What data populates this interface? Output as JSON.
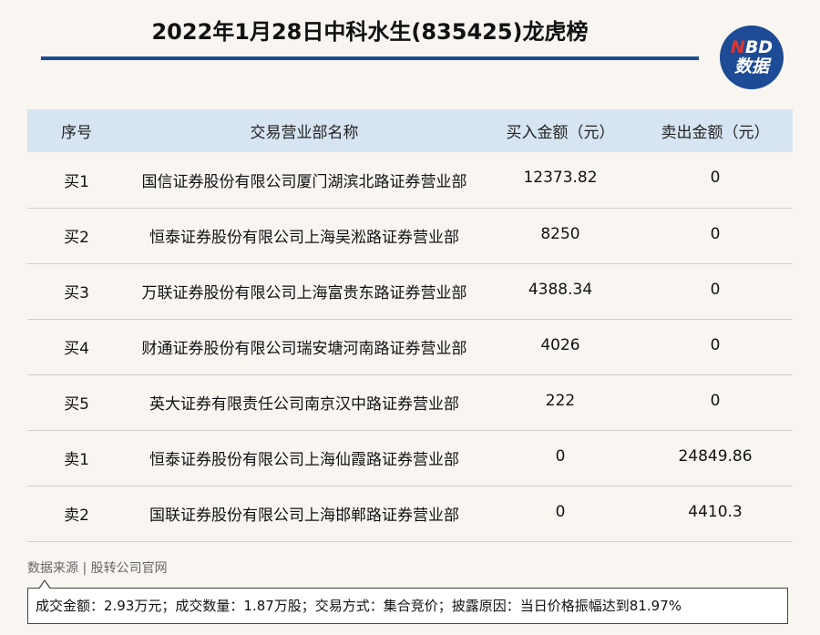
{
  "title": "2022年1月28日中科水生(835425)龙虎榜",
  "logo": {
    "line1_n": "N",
    "line1_rest": "BD",
    "line2": "数据"
  },
  "table": {
    "headers": [
      "序号",
      "交易营业部名称",
      "买入金额（元）",
      "卖出金额（元）"
    ],
    "rows": [
      {
        "seq": "买1",
        "name": "国信证券股份有限公司厦门湖滨北路证券营业部",
        "buy": "12373.82",
        "sell": "0"
      },
      {
        "seq": "买2",
        "name": "恒泰证券股份有限公司上海吴淞路证券营业部",
        "buy": "8250",
        "sell": "0"
      },
      {
        "seq": "买3",
        "name": "万联证券股份有限公司上海富贵东路证券营业部",
        "buy": "4388.34",
        "sell": "0"
      },
      {
        "seq": "买4",
        "name": "财通证券股份有限公司瑞安塘河南路证券营业部",
        "buy": "4026",
        "sell": "0"
      },
      {
        "seq": "买5",
        "name": "英大证券有限责任公司南京汉中路证券营业部",
        "buy": "222",
        "sell": "0"
      },
      {
        "seq": "卖1",
        "name": "恒泰证券股份有限公司上海仙霞路证券营业部",
        "buy": "0",
        "sell": "24849.86"
      },
      {
        "seq": "卖2",
        "name": "国联证券股份有限公司上海邯郸路证券营业部",
        "buy": "0",
        "sell": "4410.3"
      }
    ]
  },
  "source": "数据来源 | 股转公司官网",
  "note": "成交金额：2.93万元；成交数量：1.87万股；交易方式：集合竞价；披露原因：当日价格振幅达到81.97%",
  "colors": {
    "accent": "#1a4a96",
    "header_bg": "#d7e5f2",
    "page_bg": "#f9f6f2",
    "logo_red": "#e2342b"
  }
}
